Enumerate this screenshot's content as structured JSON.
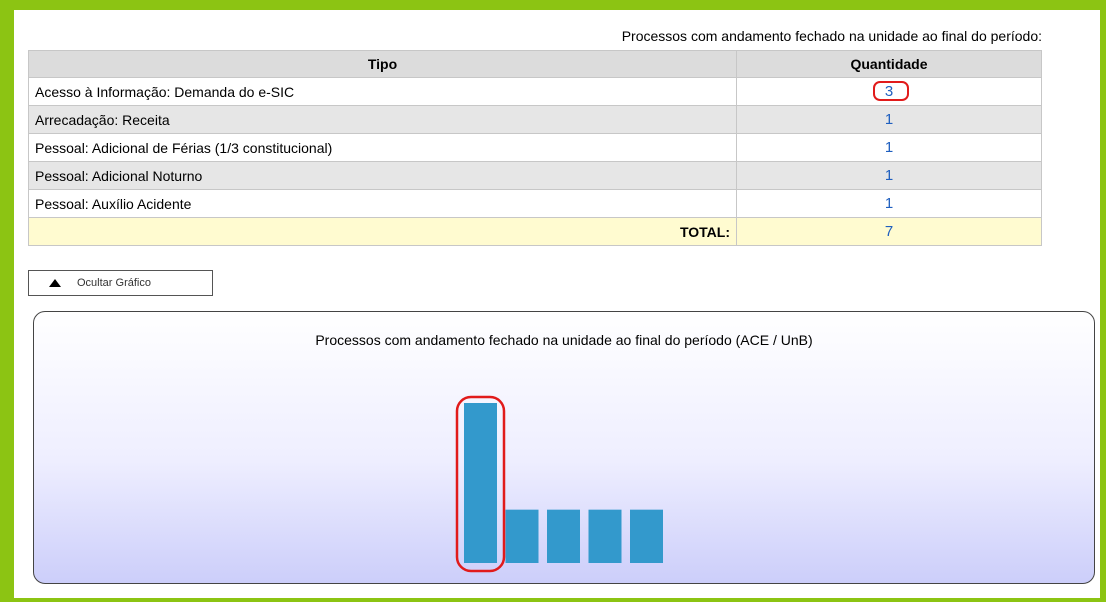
{
  "header": {
    "caption": "Processos com andamento fechado na unidade ao final do período:"
  },
  "table": {
    "columns": [
      "Tipo",
      "Quantidade"
    ],
    "rows": [
      {
        "tipo": "Acesso à Informação: Demanda do e-SIC",
        "quantidade": "3"
      },
      {
        "tipo": "Arrecadação: Receita",
        "quantidade": "1"
      },
      {
        "tipo": "Pessoal: Adicional de Férias (1/3 constitucional)",
        "quantidade": "1"
      },
      {
        "tipo": "Pessoal: Adicional Noturno",
        "quantidade": "1"
      },
      {
        "tipo": "Pessoal: Auxílio Acidente",
        "quantidade": "1"
      }
    ],
    "total_label": "TOTAL:",
    "total_value": "7"
  },
  "toggle": {
    "label": "Ocultar Gráfico",
    "icon": "triangle-up-icon"
  },
  "chart_data": {
    "type": "bar",
    "title": "Processos com andamento fechado na unidade ao final do período (ACE / UnB)",
    "categories": [
      "Acesso à Informação: Demanda do e-SIC",
      "Arrecadação: Receita",
      "Pessoal: Adicional de Férias (1/3 constitucional)",
      "Pessoal: Adicional Noturno",
      "Pessoal: Auxílio Acidente"
    ],
    "values": [
      3,
      1,
      1,
      1,
      1
    ],
    "ylim": [
      0,
      3
    ],
    "bar_color": "#3399cc",
    "highlight_color": "#e11b1b"
  },
  "colors": {
    "frame": "#8cc413",
    "link": "#1f5fbf",
    "header_bg": "#dcdcdc",
    "total_bg": "#fffbd0"
  }
}
